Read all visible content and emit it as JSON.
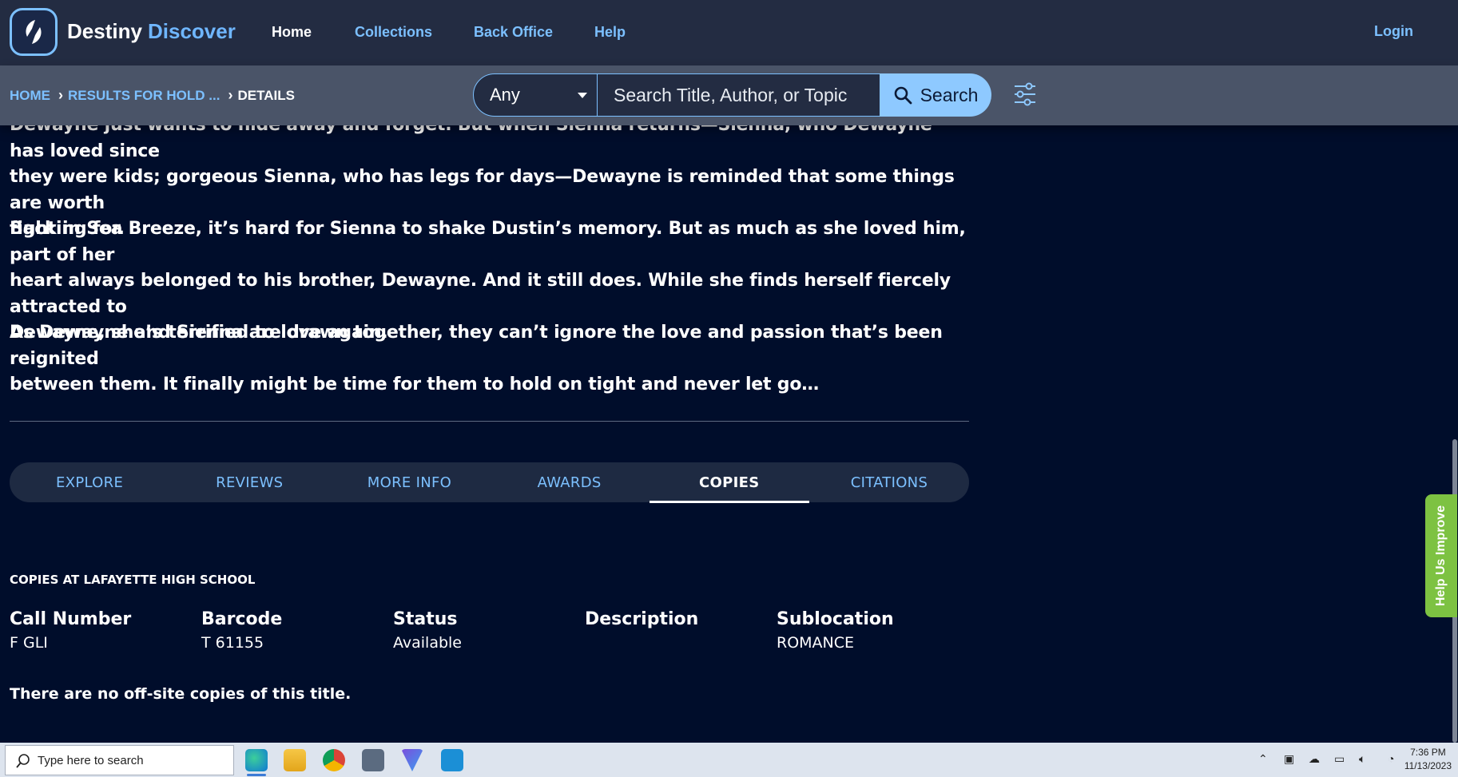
{
  "brand": {
    "name_1": "Destiny",
    "name_2": "Discover"
  },
  "nav": {
    "home": "Home",
    "collections": "Collections",
    "back_office": "Back Office",
    "help": "Help",
    "login": "Login"
  },
  "breadcrumb": {
    "home": "HOME",
    "results": "RESULTS FOR HOLD ...",
    "details": "DETAILS"
  },
  "search": {
    "scope": "Any",
    "placeholder": "Search Title, Author, or Topic",
    "button": "Search"
  },
  "description": {
    "p1_line1": "Dewayne just wants to hide away and forget. But when Sienna returns—Sienna, who Dewayne has loved since",
    "p1_line2": "they were kids; gorgeous Sienna, who has legs for days—Dewayne is reminded that some things are worth",
    "p1_line3": "fighting for.",
    "p2_line1": "Back in Sea Breeze, it’s hard for Sienna to shake Dustin’s memory. But as much as she loved him, part of her",
    "p2_line2": "heart always belonged to his brother, Dewayne. And it still does. While she finds herself fiercely attracted to",
    "p2_line3": "Dewayne, she’s terrified to love again.",
    "p3_line1": "As Dewayne and Sienna are drawn together, they can’t ignore the love and passion that’s been reignited",
    "p3_line2": "between them. It finally might be time for them to hold on tight and never let go…"
  },
  "tabs": {
    "explore": "EXPLORE",
    "reviews": "REVIEWS",
    "more_info": "MORE INFO",
    "awards": "AWARDS",
    "copies": "COPIES",
    "citations": "CITATIONS"
  },
  "copies": {
    "heading": "COPIES AT LAFAYETTE HIGH SCHOOL",
    "call_number_label": "Call Number",
    "call_number": "F GLI",
    "barcode_label": "Barcode",
    "barcode": "T 61155",
    "status_label": "Status",
    "status": "Available",
    "description_label": "Description",
    "description": "",
    "sublocation_label": "Sublocation",
    "sublocation": "ROMANCE",
    "offsite": "There are no off-site copies of this title."
  },
  "help_tab": "Help Us Improve",
  "taskbar": {
    "search_placeholder": "Type here to search",
    "time": "7:36 PM",
    "date": "11/13/2023"
  }
}
